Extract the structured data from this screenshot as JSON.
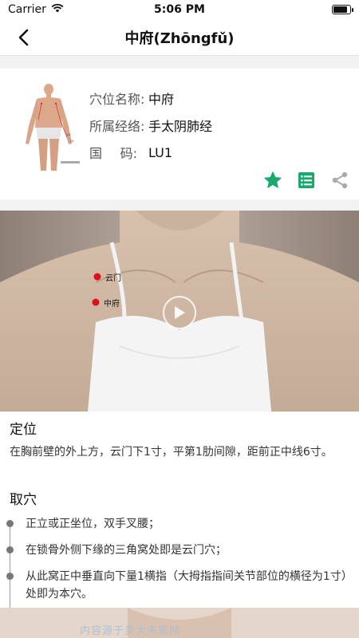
{
  "status": {
    "carrier": "Carrier",
    "time": "5:06 PM",
    "battery_level": 0.9
  },
  "nav": {
    "title": "中府(Zhōngfǔ)"
  },
  "info": {
    "name_label": "穴位名称:",
    "name_value": "中府",
    "meridian_label": "所属经络:",
    "meridian_value": "手太阴肺经",
    "code_label_1": "国",
    "code_label_2": "码:",
    "code_value": "LU1"
  },
  "actions": {
    "star_color": "#1aa96b",
    "list_color": "#1aa96b",
    "share_color": "#aaaaaa"
  },
  "video": {
    "label_upper": "云门",
    "label_lower": "中府"
  },
  "location": {
    "title": "定位",
    "text": "在胸前壁的外上方，云门下1寸，平第1肋间隙，距前正中线6寸。"
  },
  "method": {
    "title": "取穴",
    "steps": [
      "正立或正坐位，双手叉腰；",
      "在锁骨外侧下缘的三角窝处即是云门穴；",
      "从此窝正中垂直向下量1横指（大拇指指间关节部位的横径为1寸）处即为本穴。"
    ]
  },
  "watermark": {
    "text": "内容源于灸大夫官网"
  }
}
